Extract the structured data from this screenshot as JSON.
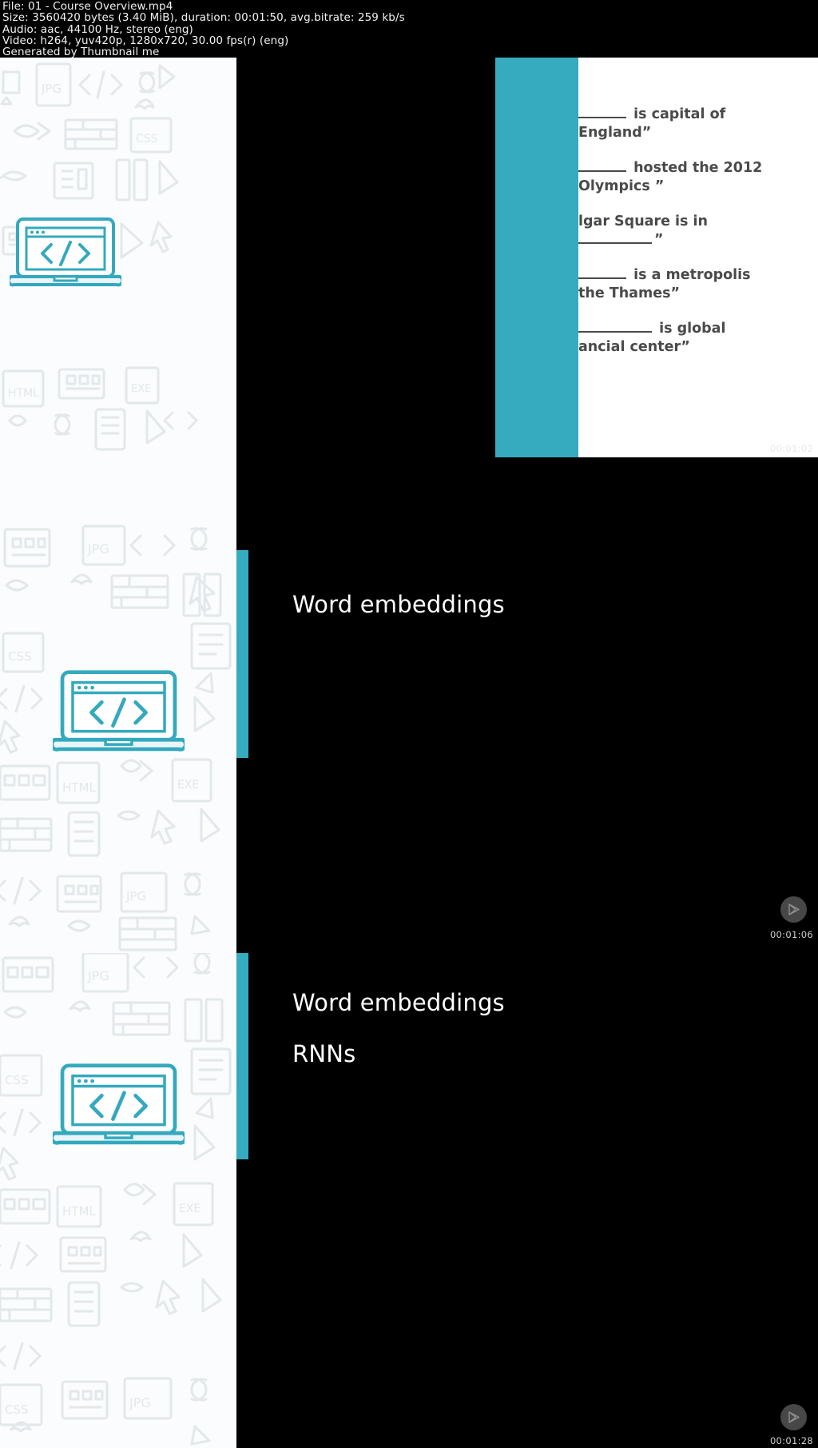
{
  "header": {
    "lines": [
      "File: 01 - Course Overview.mp4",
      "Size: 3560420 bytes (3.40 MiB), duration: 00:01:50, avg.bitrate: 259 kb/s",
      "Audio: aac, 44100 Hz, stereo (eng)",
      "Video: h264, yuv420p, 1280x720, 30.00 fps(r) (eng)",
      "Generated by Thumbnail me"
    ],
    "file_label": "File: 01 - Course Overview.mp4",
    "size_label": "Size: 3560420 bytes (3.40 MiB), duration: 00:01:50, avg.bitrate: 259 kb/s",
    "audio_label": "Audio: aac, 44100 Hz, stereo (eng)",
    "video_label": "Video: h264, yuv420p, 1280x720, 30.00 fps(r) (eng)",
    "generator_label": "Generated by Thumbnail me"
  },
  "colors": {
    "accent_teal": "#36aabf",
    "slide_bg_white": "#ffffff",
    "slide_bg_dark": "#000000",
    "text_dark": "#4a4a4a",
    "text_light": "#ffffff",
    "sidebar_bg": "#fafcfd",
    "pattern_stroke": "#e4e8ea"
  },
  "thumbnails": [
    {
      "index": 1,
      "timestamp": "00:01:02",
      "play_icon": "play-icon",
      "slide_type": "quiz-white",
      "questions": [
        {
          "line1_blank": true,
          "line1": " is capital of",
          "line2": "England”",
          "line2_blank": false
        },
        {
          "line1_blank": true,
          "line1": " hosted the 2012",
          "line2": "Olympics ”",
          "line2_blank": false
        },
        {
          "line1_blank": false,
          "line1": "lgar Square is in",
          "line2": "”",
          "line2_blank": true
        },
        {
          "line1_blank": true,
          "line1": " is a metropolis",
          "line2": "the Thames”",
          "line2_blank": false
        },
        {
          "line1_blank": true,
          "line1": " is global",
          "line2": "ancial center”",
          "line2_blank": false
        }
      ]
    },
    {
      "index": 2,
      "timestamp": "00:01:06",
      "play_icon": "play-icon",
      "slide_type": "bullets-dark",
      "bullets": [
        "Word embeddings"
      ]
    },
    {
      "index": 3,
      "timestamp": "00:01:28",
      "play_icon": "play-icon",
      "slide_type": "bullets-dark",
      "bullets": [
        "Word embeddings",
        "RNNs"
      ]
    }
  ],
  "sidebar": {
    "illustration": "laptop-code-icon",
    "pattern_icons": [
      "jpg-file-icon",
      "code-brackets-icon",
      "cursor-arrow-icon",
      "link-chain-icon",
      "fish-bone-icon",
      "firewall-brick-icon",
      "css-file-icon",
      "battery-icon",
      "vr-goggles-icon",
      "book-icon",
      "html-file-icon",
      "server-rack-icon",
      "bug-icon",
      "exe-file-icon",
      "mobile-phone-icon",
      "document-icon"
    ]
  }
}
